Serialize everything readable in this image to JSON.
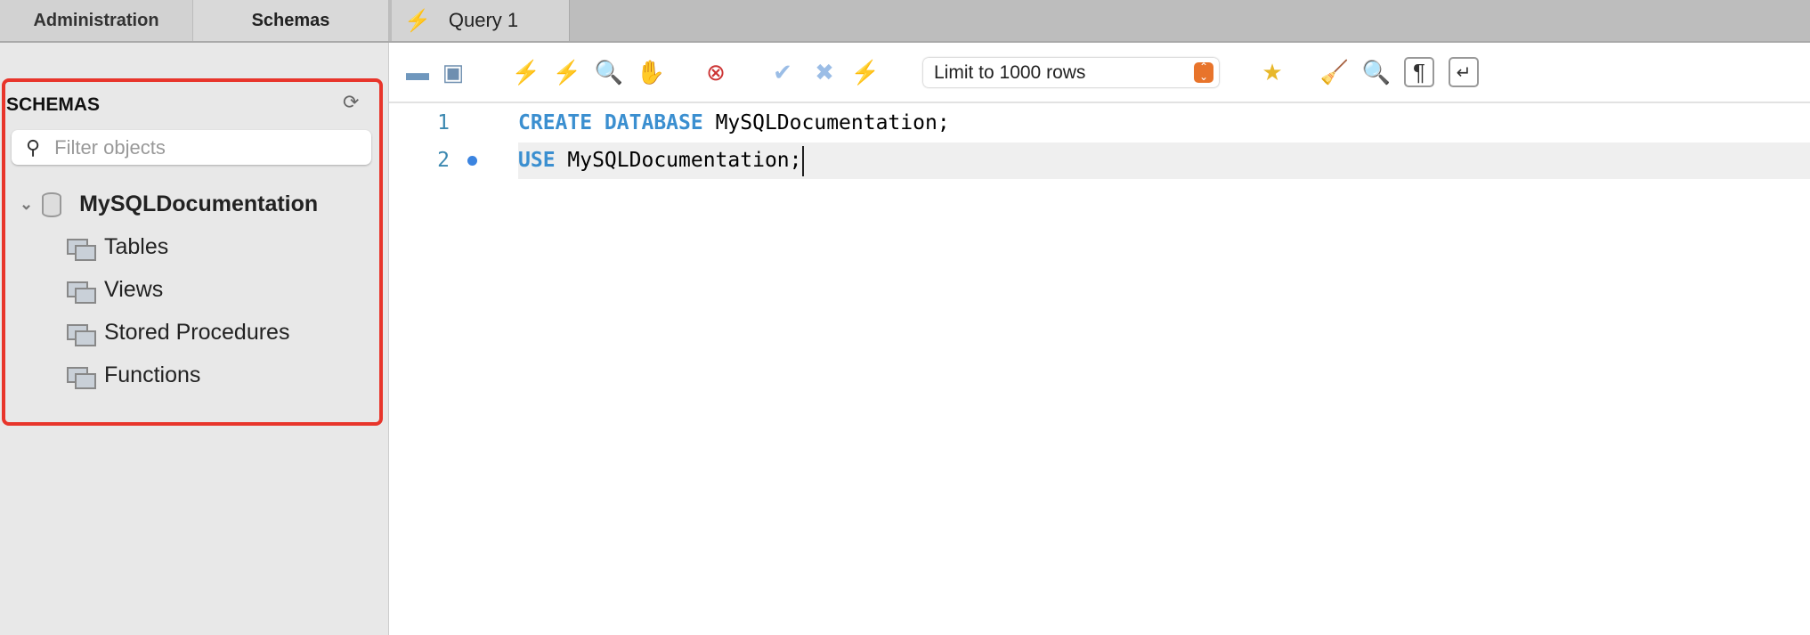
{
  "tabs": {
    "administration": "Administration",
    "schemas": "Schemas",
    "query": "Query 1"
  },
  "sidebar": {
    "title": "SCHEMAS",
    "filter_placeholder": "Filter objects",
    "database": "MySQLDocumentation",
    "items": [
      {
        "label": "Tables"
      },
      {
        "label": "Views"
      },
      {
        "label": "Stored Procedures"
      },
      {
        "label": "Functions"
      }
    ]
  },
  "toolbar": {
    "limit": "Limit to 1000 rows"
  },
  "editor": {
    "lines": [
      {
        "num": "1",
        "kw": "CREATE DATABASE",
        "rest": " MySQLDocumentation;"
      },
      {
        "num": "2",
        "kw": "USE",
        "rest": " MySQLDocumentation;"
      }
    ]
  },
  "colors": {
    "highlight_border": "#e8352b",
    "keyword": "#3b8fd0",
    "accent": "#e8742b"
  }
}
